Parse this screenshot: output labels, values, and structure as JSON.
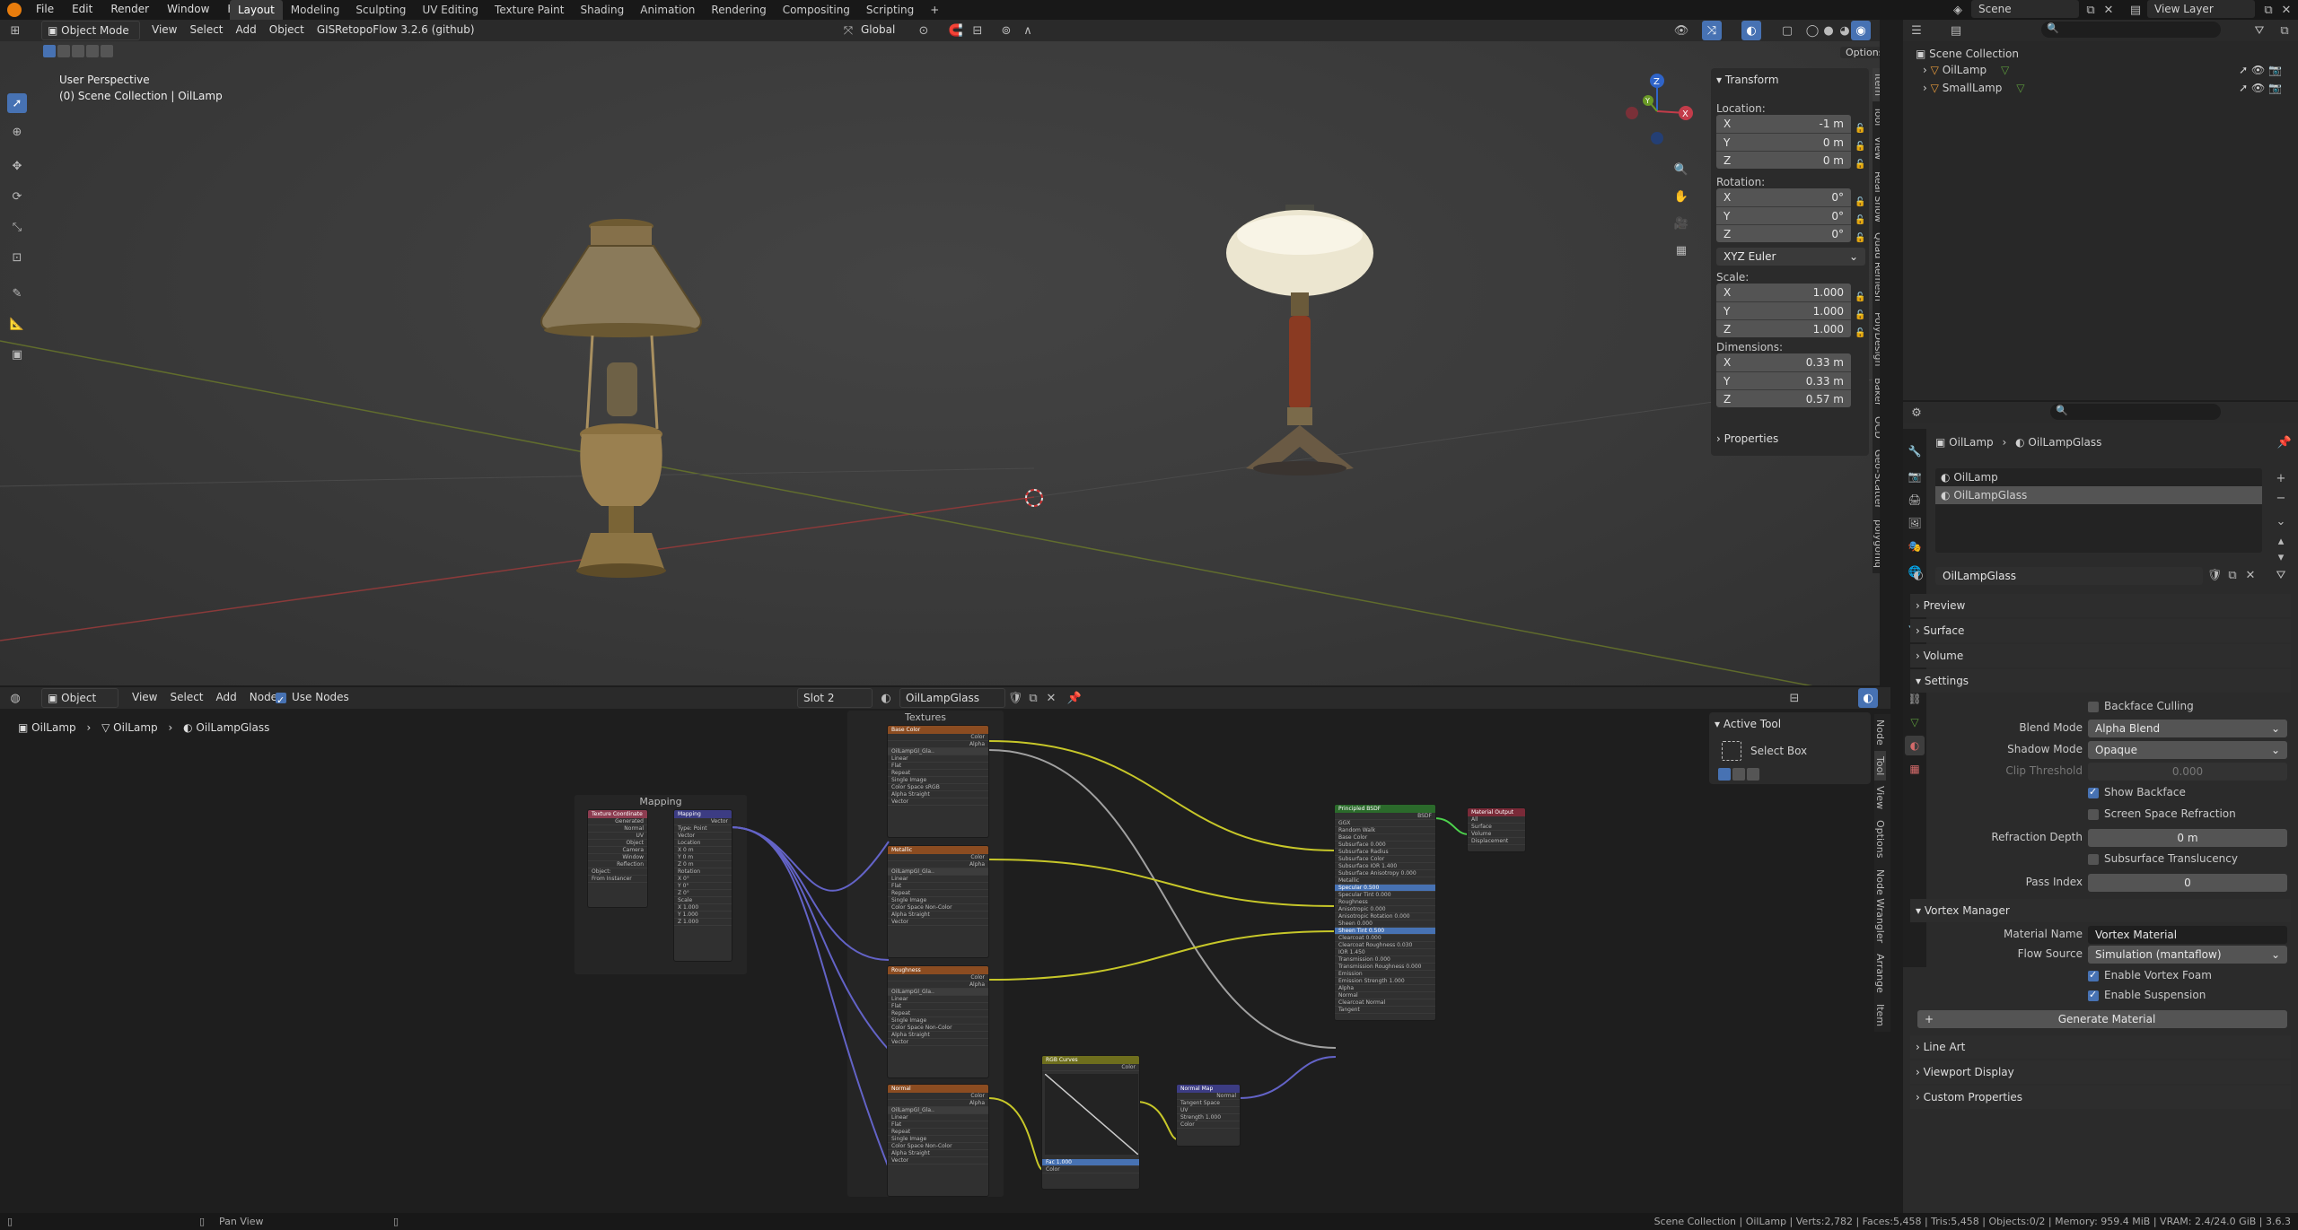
{
  "topbar": {
    "menus": [
      "File",
      "Edit",
      "Render",
      "Window",
      "Help"
    ],
    "workspaces": [
      "Layout",
      "Modeling",
      "Sculpting",
      "UV Editing",
      "Texture Paint",
      "Shading",
      "Animation",
      "Rendering",
      "Compositing",
      "Scripting"
    ],
    "active_workspace": "Layout",
    "add_workspace": "+",
    "scene": "Scene",
    "view_layer": "View Layer"
  },
  "viewport": {
    "mode": "Object Mode",
    "menus": [
      "View",
      "Select",
      "Add",
      "Object",
      "GIS"
    ],
    "addon": "RetopoFlow 3.2.6 (github)",
    "orientation": "Global",
    "options": "Options",
    "overlay_title": "User Perspective",
    "overlay_subtitle": "(0) Scene Collection | OilLamp",
    "gizmo": {
      "x": "X",
      "y": "Y",
      "z": "Z"
    },
    "transform": {
      "title": "Transform",
      "location_label": "Location:",
      "location": [
        {
          "axis": "X",
          "value": "-1 m"
        },
        {
          "axis": "Y",
          "value": "0 m"
        },
        {
          "axis": "Z",
          "value": "0 m"
        }
      ],
      "rotation_label": "Rotation:",
      "rotation": [
        {
          "axis": "X",
          "value": "0°"
        },
        {
          "axis": "Y",
          "value": "0°"
        },
        {
          "axis": "Z",
          "value": "0°"
        }
      ],
      "rotation_mode": "XYZ Euler",
      "scale_label": "Scale:",
      "scale": [
        {
          "axis": "X",
          "value": "1.000"
        },
        {
          "axis": "Y",
          "value": "1.000"
        },
        {
          "axis": "Z",
          "value": "1.000"
        }
      ],
      "dimensions_label": "Dimensions:",
      "dimensions": [
        {
          "axis": "X",
          "value": "0.33 m"
        },
        {
          "axis": "Y",
          "value": "0.33 m"
        },
        {
          "axis": "Z",
          "value": "0.57 m"
        }
      ],
      "properties": "Properties"
    },
    "side_tabs": [
      "Item",
      "Tool",
      "View",
      "Real Snow",
      "Quad Remesh",
      "PolyDesign",
      "Baker",
      "OCD",
      "Geo-Scatter",
      "polygoniq"
    ]
  },
  "node_editor": {
    "editor_type": "Object",
    "menus": [
      "View",
      "Select",
      "Add",
      "Node"
    ],
    "use_nodes": "Use Nodes",
    "slot": "Slot 2",
    "material": "OilLampGlass",
    "breadcrumb": [
      "OilLamp",
      "OilLamp",
      "OilLampGlass"
    ],
    "frame_textures": "Textures",
    "frame_mapping": "Mapping",
    "tool_title": "Active Tool",
    "tool_name": "Select Box",
    "side_tabs": [
      "Node",
      "Tool",
      "View",
      "Options",
      "Node Wrangler",
      "Arrange",
      "Item"
    ],
    "nodes": {
      "texcoord": {
        "title": "Texture Coordinate",
        "rows": [
          "Generated",
          "Normal",
          "UV",
          "Object",
          "Camera",
          "Window",
          "Reflection",
          "Object:",
          "From Instancer"
        ]
      },
      "mapping": {
        "title": "Mapping",
        "rows": [
          "Vector",
          "Type: Point",
          "Vector",
          "Location",
          "X 0 m",
          "Y 0 m",
          "Z 0 m",
          "Rotation",
          "X 0°",
          "Y 0°",
          "Z 0°",
          "Scale",
          "X 1.000",
          "Y 1.000",
          "Z 1.000"
        ]
      },
      "tex1": {
        "title": "Base Color",
        "rows": [
          "Color",
          "Alpha",
          "OilLampGl_Gla..",
          "Linear",
          "Flat",
          "Repeat",
          "Single Image",
          "Color Space  sRGB",
          "Alpha  Straight",
          "Vector"
        ]
      },
      "tex2": {
        "title": "Metallic",
        "rows": [
          "Color",
          "Alpha",
          "OilLampGl_Gla..",
          "Linear",
          "Flat",
          "Repeat",
          "Single Image",
          "Color Space  Non-Color",
          "Alpha  Straight",
          "Vector"
        ]
      },
      "tex3": {
        "title": "Roughness",
        "rows": [
          "Color",
          "Alpha",
          "OilLampGl_Gla..",
          "Linear",
          "Flat",
          "Repeat",
          "Single Image",
          "Color Space  Non-Color",
          "Alpha  Straight",
          "Vector"
        ]
      },
      "tex4": {
        "title": "Normal",
        "rows": [
          "Color",
          "Alpha",
          "OilLampGl_Gla..",
          "Linear",
          "Flat",
          "Repeat",
          "Single Image",
          "Color Space  Non-Color",
          "Alpha  Straight",
          "Vector"
        ]
      },
      "rgbcurves": {
        "title": "RGB Curves",
        "rows": [
          "Color",
          "Fac 1.000",
          "Color"
        ]
      },
      "normalmap": {
        "title": "Normal Map",
        "rows": [
          "Normal",
          "Tangent Space",
          "UV",
          "Strength 1.000",
          "Color"
        ]
      },
      "bsdf": {
        "title": "Principled BSDF",
        "rows": [
          "BSDF",
          "GGX",
          "Random Walk",
          "Base Color",
          "Subsurface 0.000",
          "Subsurface Radius",
          "Subsurface Color",
          "Subsurface IOR 1.400",
          "Subsurface Anisotropy 0.000",
          "Metallic",
          "Specular 0.500",
          "Specular Tint 0.000",
          "Roughness",
          "Anisotropic 0.000",
          "Anisotropic Rotation 0.000",
          "Sheen 0.000",
          "Sheen Tint 0.500",
          "Clearcoat 0.000",
          "Clearcoat Roughness 0.030",
          "IOR 1.450",
          "Transmission 0.000",
          "Transmission Roughness 0.000",
          "Emission",
          "Emission Strength 1.000",
          "Alpha",
          "Normal",
          "Clearcoat Normal",
          "Tangent"
        ]
      },
      "output": {
        "title": "Material Output",
        "rows": [
          "All",
          "Surface",
          "Volume",
          "Displacement"
        ]
      }
    }
  },
  "outliner": {
    "root": "Scene Collection",
    "items": [
      "OilLamp",
      "SmallLamp"
    ]
  },
  "properties": {
    "breadcrumb_object": "OilLamp",
    "breadcrumb_material": "OilLampGlass",
    "slots": [
      "OilLamp",
      "OilLampGlass"
    ],
    "material_name": "OilLampGlass",
    "sections": {
      "preview": "Preview",
      "surface": "Surface",
      "volume": "Volume",
      "settings": "Settings"
    },
    "settings": {
      "backface_culling": "Backface Culling",
      "blend_mode_label": "Blend Mode",
      "blend_mode": "Alpha Blend",
      "shadow_mode_label": "Shadow Mode",
      "shadow_mode": "Opaque",
      "clip_label": "Clip Threshold",
      "clip": "0.000",
      "show_backface": "Show Backface",
      "ssr": "Screen Space Refraction",
      "refraction_label": "Refraction Depth",
      "refraction": "0 m",
      "sss": "Subsurface Translucency",
      "pass_label": "Pass Index",
      "pass": "0"
    },
    "vortex": {
      "title": "Vortex Manager",
      "material_label": "Material Name",
      "material": "Vortex Material",
      "flow_label": "Flow Source",
      "flow": "Simulation (mantaflow)",
      "foam": "Enable Vortex Foam",
      "suspension": "Enable Suspension",
      "generate": "Generate Material"
    },
    "more_sections": [
      "Line Art",
      "Viewport Display",
      "Custom Properties"
    ]
  },
  "statusbar": {
    "left": "Pan View",
    "right": "Scene Collection | OilLamp | Verts:2,782 | Faces:5,458 | Tris:5,458 | Objects:0/2 | Memory: 959.4 MiB | VRAM: 2.4/24.0 GiB | 3.6.3"
  },
  "colors": {
    "accent": "#4772b3",
    "active_orange": "#e89b3b",
    "bg": "#1d1d1d",
    "panel": "#2a2a2a"
  }
}
